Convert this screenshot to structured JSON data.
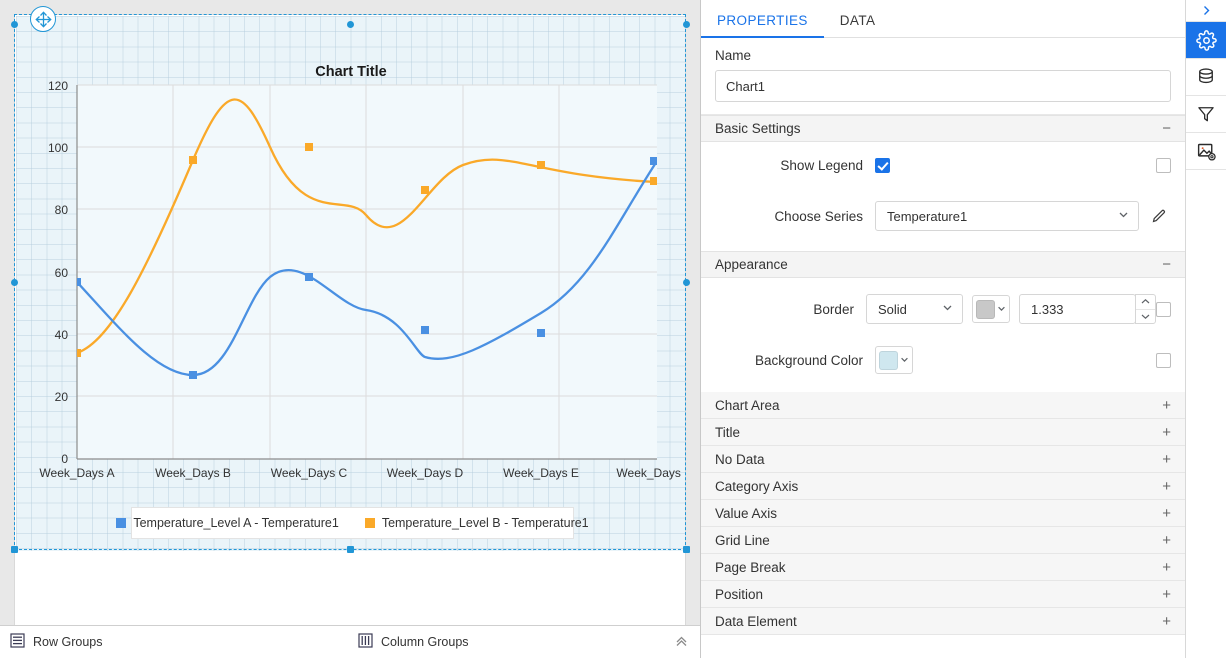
{
  "designer": {
    "move_handle_icon": "move-cross-icon",
    "chart": {
      "title": "Chart Title"
    },
    "group_bar": {
      "row_groups_label": "Row Groups",
      "row_groups_icon": "row-groups-icon",
      "column_groups_label": "Column Groups",
      "column_groups_icon": "column-groups-icon",
      "collapse_icon": "chevron-double-up-icon"
    }
  },
  "chart_data": {
    "type": "line",
    "title": "Chart Title",
    "xlabel": "",
    "ylabel": "",
    "ylim": [
      0,
      120
    ],
    "yticks": [
      0,
      20,
      40,
      60,
      80,
      100,
      120
    ],
    "grid": true,
    "smooth": true,
    "legend_position": "bottom",
    "categories": [
      "Week_Days A",
      "Week_Days B",
      "Week_Days C",
      "Week_Days D",
      "Week_Days E",
      "Week_Days F"
    ],
    "series": [
      {
        "name": "Temperature_Level A - Temperature1",
        "color": "#4a90e2",
        "values": [
          57,
          27,
          65,
          48,
          47,
          96
        ]
      },
      {
        "name": "Temperature_Level B - Temperature1",
        "color": "#faa929",
        "values": [
          34,
          96,
          100,
          86,
          94,
          89
        ]
      }
    ]
  },
  "properties_panel": {
    "tabs": [
      {
        "label": "PROPERTIES",
        "active": true
      },
      {
        "label": "DATA",
        "active": false
      }
    ],
    "name": {
      "label": "Name",
      "value": "Chart1",
      "placeholder": "Name"
    },
    "basic_settings": {
      "header": "Basic Settings",
      "toggle_sign": "−",
      "show_legend": {
        "label": "Show Legend",
        "checked": true,
        "expression_checkbox": false
      },
      "choose_series": {
        "label": "Choose Series",
        "value": "Temperature1",
        "caret_icon": "chevron-down-icon",
        "edit_icon": "pencil-icon"
      }
    },
    "appearance": {
      "header": "Appearance",
      "toggle_sign": "−",
      "border": {
        "label": "Border",
        "style_value": "Solid",
        "color_value": "#c8c8c8",
        "width_value": "1.333",
        "expression_checkbox": false
      },
      "background_color": {
        "label": "Background Color",
        "color_value": "#cfe7ef",
        "expression_checkbox": false
      }
    },
    "sections": [
      {
        "label": "Chart Area",
        "sign": "+"
      },
      {
        "label": "Title",
        "sign": "+"
      },
      {
        "label": "No Data",
        "sign": "+"
      },
      {
        "label": "Category Axis",
        "sign": "+"
      },
      {
        "label": "Value Axis",
        "sign": "+"
      },
      {
        "label": "Grid Line",
        "sign": "+"
      },
      {
        "label": "Page Break",
        "sign": "+"
      },
      {
        "label": "Position",
        "sign": "+"
      },
      {
        "label": "Data Element",
        "sign": "+"
      }
    ]
  },
  "rail": {
    "expand_icon": "chevron-right-icon",
    "buttons": [
      {
        "icon": "gear-icon",
        "active": true
      },
      {
        "icon": "database-icon",
        "active": false
      },
      {
        "icon": "filter-funnel-icon",
        "active": false
      },
      {
        "icon": "image-settings-icon",
        "active": false
      }
    ]
  },
  "colors": {
    "accent": "#1a73e8",
    "selection": "#2196d6",
    "series_a": "#4a90e2",
    "series_b": "#faa929",
    "chart_bg": "#eaf4f9"
  }
}
